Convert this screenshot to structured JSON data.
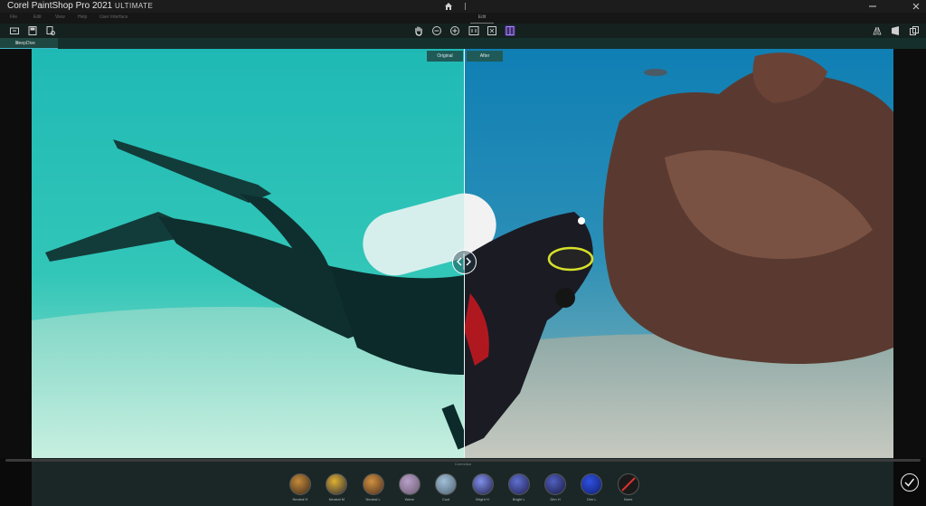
{
  "app": {
    "brand": "Corel",
    "product": "PaintShop",
    "product2": "Pro",
    "year": "2021",
    "edition": "ULTIMATE"
  },
  "menu": [
    "File",
    "Edit",
    "View",
    "Help",
    "User Interface"
  ],
  "workspace_tab": "Edit",
  "document_tab": "DeepDive",
  "compare": {
    "original_label": "Original",
    "after_label": "After"
  },
  "toolbar_icons": [
    "open-icon",
    "save-icon",
    "settings-icon",
    "pan-hand-icon",
    "zoom-out-icon",
    "zoom-in-icon",
    "actual-size-icon",
    "fit-window-icon",
    "split-view-icon",
    "mirror-icon",
    "layers-icon",
    "export-icon"
  ],
  "corrections": {
    "label": "Correction",
    "presets": [
      {
        "label": "Neutral H",
        "color1": "#c58a3a",
        "color2": "#3a2a1a"
      },
      {
        "label": "Neutral M",
        "color1": "#e0b030",
        "color2": "#2a2a3a"
      },
      {
        "label": "Neutral L",
        "color1": "#d09040",
        "color2": "#4a3020"
      },
      {
        "label": "Warm",
        "color1": "#b8a0c8",
        "color2": "#6a5a70"
      },
      {
        "label": "Cool",
        "color1": "#a0c0d8",
        "color2": "#506070"
      },
      {
        "label": "Bright H",
        "color1": "#8090e8",
        "color2": "#20204a"
      },
      {
        "label": "Bright L",
        "color1": "#6070d0",
        "color2": "#202050"
      },
      {
        "label": "Dim H",
        "color1": "#5060c0",
        "color2": "#1a1a40"
      },
      {
        "label": "Dim L",
        "color1": "#3050e0",
        "color2": "#102070"
      },
      {
        "label": "None",
        "color1": "#1a1a1a",
        "color2": "#1a1a1a"
      }
    ]
  },
  "colors": {
    "accent": "#3fb6c9",
    "original_water": "#2bc4bc",
    "after_water": "#1c8cc0",
    "none_slash": "#e03030"
  }
}
